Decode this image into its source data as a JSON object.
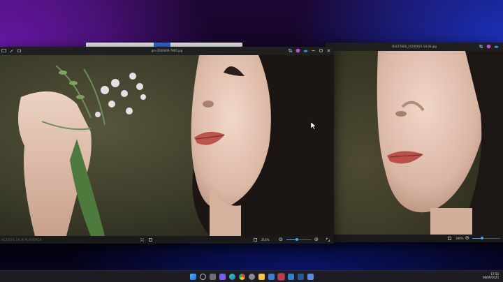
{
  "desktop": {
    "accent": "#6a18a8"
  },
  "window_left": {
    "title": "gm-2000609-7865.jpg",
    "status_text": "ACCESS 16:9 PLAYBACK",
    "zoom": "214%",
    "zoom_fraction": 0.42,
    "toolbar_icons": [
      "image-icon",
      "edit-icon",
      "share-icon"
    ],
    "right_icons": [
      "crop-icon",
      "palette-icon",
      "onedrive-icon",
      "minimize-icon",
      "maximize-icon",
      "close-icon"
    ]
  },
  "window_right": {
    "title": "DSCF7826_20200925-10-26.jpg",
    "zoom": "180%",
    "zoom_fraction": 0.35,
    "right_icons": [
      "crop-icon",
      "palette-icon",
      "onedrive-icon"
    ]
  },
  "taskbar": {
    "icons": [
      "start-icon",
      "search-icon",
      "task-view-icon",
      "chat-icon",
      "edge-icon",
      "chrome-icon",
      "settings-icon",
      "file-explorer-icon",
      "store-icon",
      "photos-icon",
      "photos-icon-2",
      "word-icon",
      "app-icon"
    ],
    "time": "17:52",
    "date": "06/09/2023"
  },
  "colors": {
    "slider": "#4aa3f0",
    "titlebar": "#1f1f1f"
  }
}
